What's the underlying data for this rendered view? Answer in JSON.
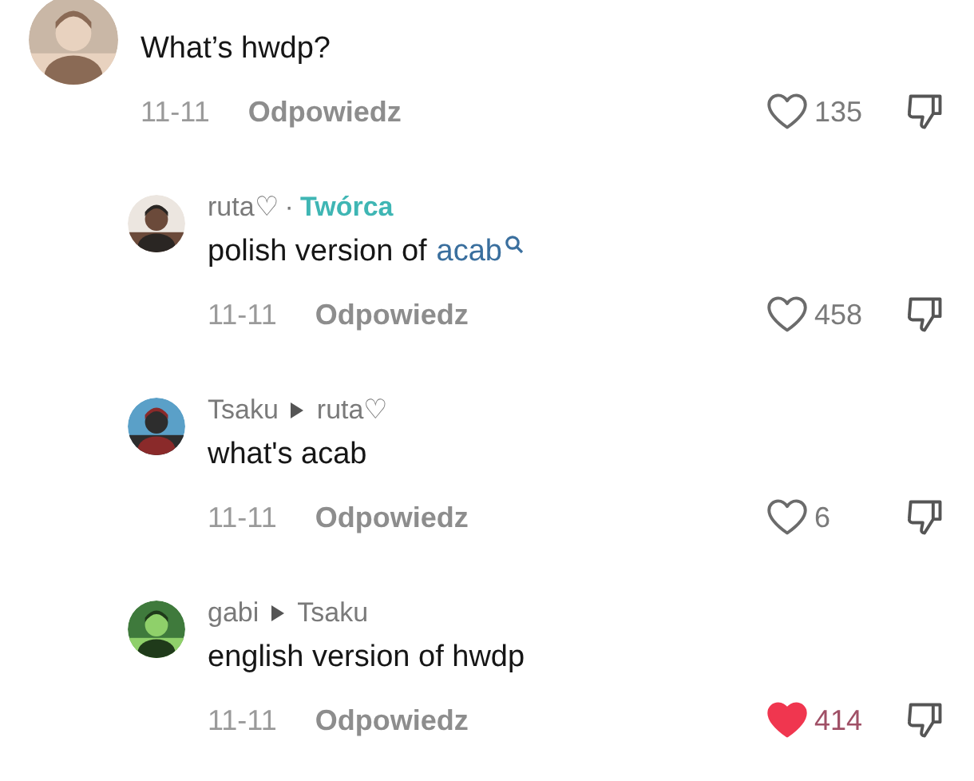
{
  "comments": [
    {
      "kind": "top",
      "text": "What’s hwdp?",
      "date": "11-11",
      "reply": "Odpowiedz",
      "likes": "135",
      "liked": false
    },
    {
      "kind": "reply",
      "author": "ruta♡",
      "separator": "·",
      "badge": "Twórca",
      "text": "polish version of",
      "link": "acab",
      "date": "11-11",
      "reply": "Odpowiedz",
      "likes": "458",
      "liked": false
    },
    {
      "kind": "reply",
      "author": "Tsaku",
      "reply_to": "ruta♡",
      "text": "what's acab",
      "date": "11-11",
      "reply": "Odpowiedz",
      "likes": "6",
      "liked": false
    },
    {
      "kind": "reply",
      "author": "gabi",
      "reply_to": "Tsaku",
      "text": "english version of hwdp",
      "date": "11-11",
      "reply": "Odpowiedz",
      "likes": "414",
      "liked": true
    }
  ]
}
